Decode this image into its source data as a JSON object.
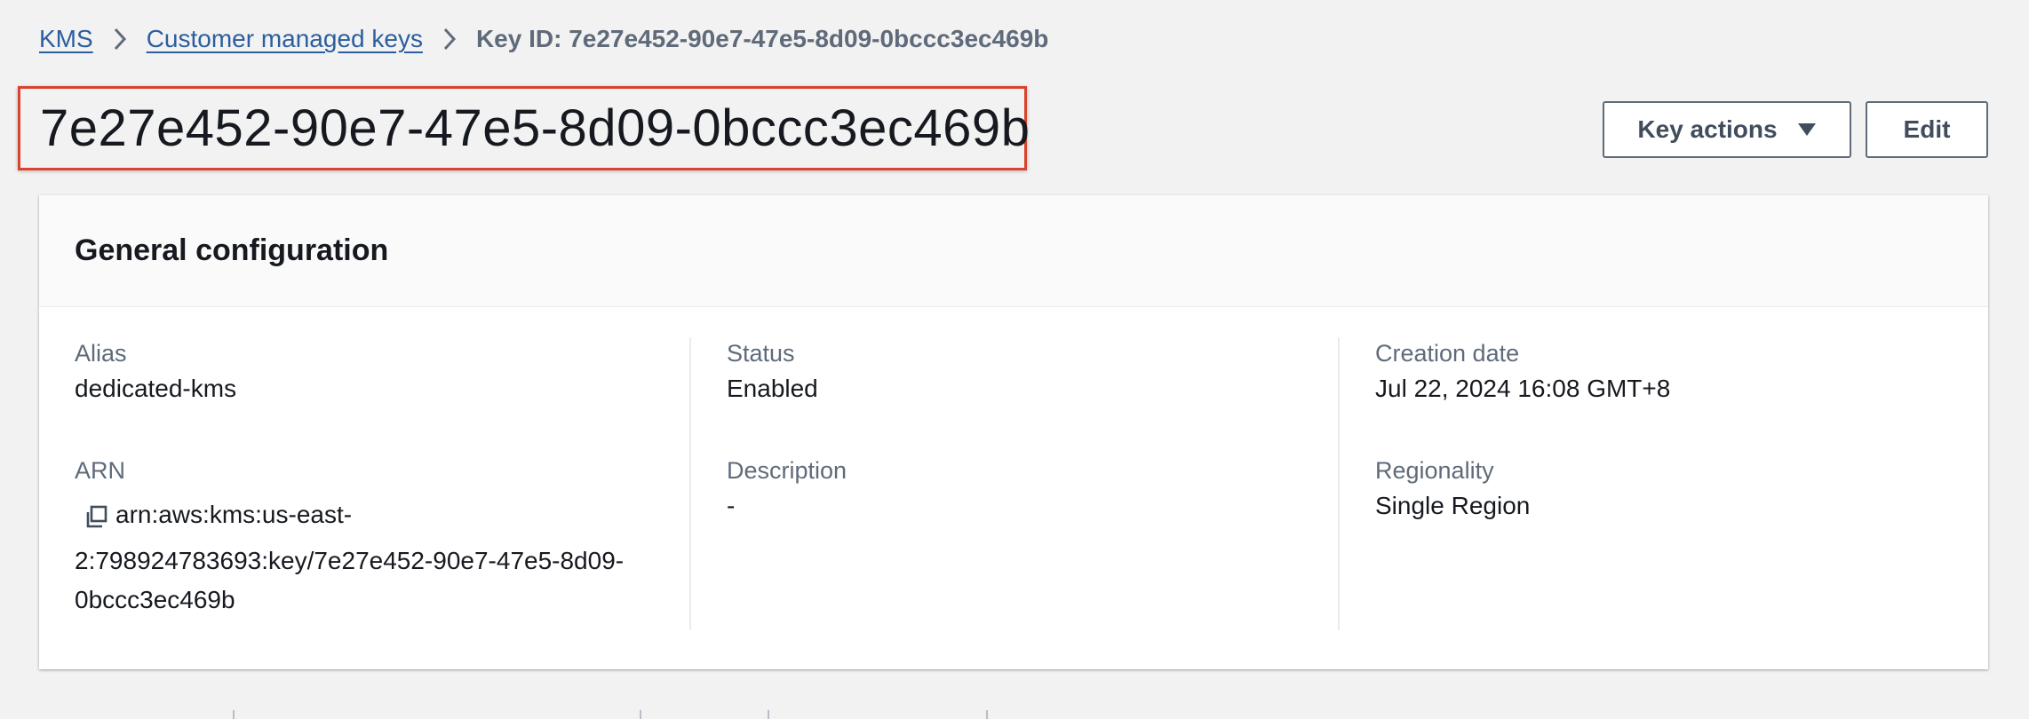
{
  "breadcrumb": {
    "items": [
      "KMS",
      "Customer managed keys"
    ],
    "current": "Key ID: 7e27e452-90e7-47e5-8d09-0bccc3ec469b"
  },
  "page": {
    "title": "7e27e452-90e7-47e5-8d09-0bccc3ec469b"
  },
  "actions": {
    "key_actions_label": "Key actions",
    "edit_label": "Edit"
  },
  "general_configuration": {
    "title": "General configuration",
    "alias": {
      "label": "Alias",
      "value": "dedicated-kms"
    },
    "arn": {
      "label": "ARN",
      "value_line1": "arn:aws:kms:us-east-",
      "value_line2": "2:798924783693:key/7e27e452-90e7-47e5-8d09-",
      "value_line3": "0bccc3ec469b"
    },
    "status": {
      "label": "Status",
      "value": "Enabled"
    },
    "description": {
      "label": "Description",
      "value": "-"
    },
    "creation_date": {
      "label": "Creation date",
      "value": "Jul 22, 2024 16:08 GMT+8"
    },
    "regionality": {
      "label": "Regionality",
      "value": "Single Region"
    }
  },
  "icons": [
    "chevron-right-icon",
    "caret-down-icon",
    "copy-icon"
  ],
  "colors": {
    "link": "#2c5e9e",
    "highlight_border": "#d9432f",
    "background": "#f2f2f2",
    "label_gray": "#5f6b7a"
  }
}
